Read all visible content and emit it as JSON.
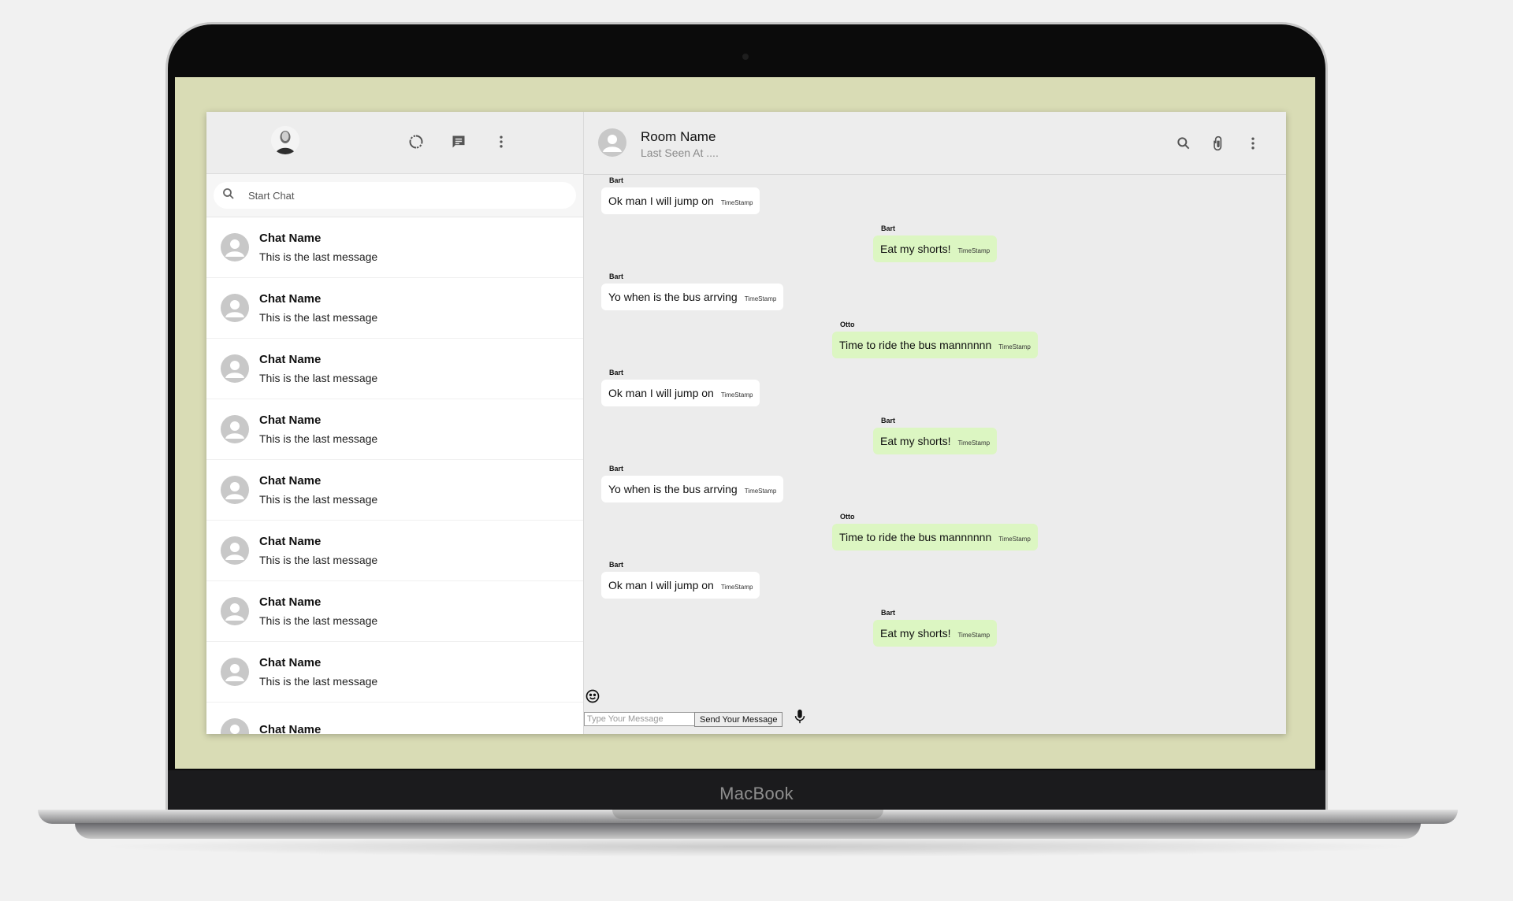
{
  "device": {
    "brand": "MacBook"
  },
  "sidebar": {
    "search_placeholder": "Start Chat",
    "header_icons": [
      "status-icon",
      "new-chat-icon",
      "more-vert-icon"
    ],
    "chats": [
      {
        "name": "Chat Name",
        "last_message": "This is the last message"
      },
      {
        "name": "Chat Name",
        "last_message": "This is the last message"
      },
      {
        "name": "Chat Name",
        "last_message": "This is the last message"
      },
      {
        "name": "Chat Name",
        "last_message": "This is the last message"
      },
      {
        "name": "Chat Name",
        "last_message": "This is the last message"
      },
      {
        "name": "Chat Name",
        "last_message": "This is the last message"
      },
      {
        "name": "Chat Name",
        "last_message": "This is the last message"
      },
      {
        "name": "Chat Name",
        "last_message": "This is the last message"
      },
      {
        "name": "Chat Name",
        "last_message": ""
      }
    ]
  },
  "room": {
    "name": "Room Name",
    "last_seen": "Last Seen At ....",
    "header_icons": [
      "search-icon",
      "attach-icon",
      "more-vert-icon"
    ]
  },
  "messages": [
    {
      "sender": "Bart",
      "text": "Ok man I will jump on",
      "timestamp": "TimeStamp",
      "sent": false
    },
    {
      "sender": "Bart",
      "text": "Eat my shorts!",
      "timestamp": "TimeStamp",
      "sent": true
    },
    {
      "sender": "Bart",
      "text": "Yo when is the bus arrving",
      "timestamp": "TimeStamp",
      "sent": false
    },
    {
      "sender": "Otto",
      "text": "Time to ride the bus mannnnnn",
      "timestamp": "TimeStamp",
      "sent": true
    },
    {
      "sender": "Bart",
      "text": "Ok man I will jump on",
      "timestamp": "TimeStamp",
      "sent": false
    },
    {
      "sender": "Bart",
      "text": "Eat my shorts!",
      "timestamp": "TimeStamp",
      "sent": true
    },
    {
      "sender": "Bart",
      "text": "Yo when is the bus arrving",
      "timestamp": "TimeStamp",
      "sent": false
    },
    {
      "sender": "Otto",
      "text": "Time to ride the bus mannnnnn",
      "timestamp": "TimeStamp",
      "sent": true
    },
    {
      "sender": "Bart",
      "text": "Ok man I will jump on",
      "timestamp": "TimeStamp",
      "sent": false
    },
    {
      "sender": "Bart",
      "text": "Eat my shorts!",
      "timestamp": "TimeStamp",
      "sent": true
    }
  ],
  "composer": {
    "placeholder": "Type Your Message",
    "send_label": "Send Your Message"
  },
  "colors": {
    "desktop": "#d9dcb5",
    "sent_bubble": "#dcf6c2",
    "received_bubble": "#ffffff",
    "panel": "#ededed"
  }
}
